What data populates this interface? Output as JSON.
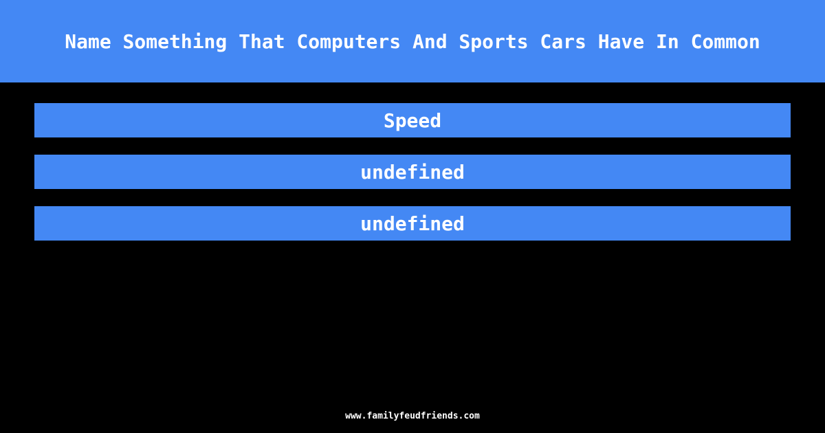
{
  "question": "Name Something That Computers And Sports Cars Have In Common",
  "answers": [
    {
      "label": "Speed"
    },
    {
      "label": "undefined"
    },
    {
      "label": "undefined"
    }
  ],
  "footer": "www.familyfeudfriends.com",
  "colors": {
    "accent": "#4488f4",
    "background": "#000000",
    "text": "#ffffff"
  }
}
